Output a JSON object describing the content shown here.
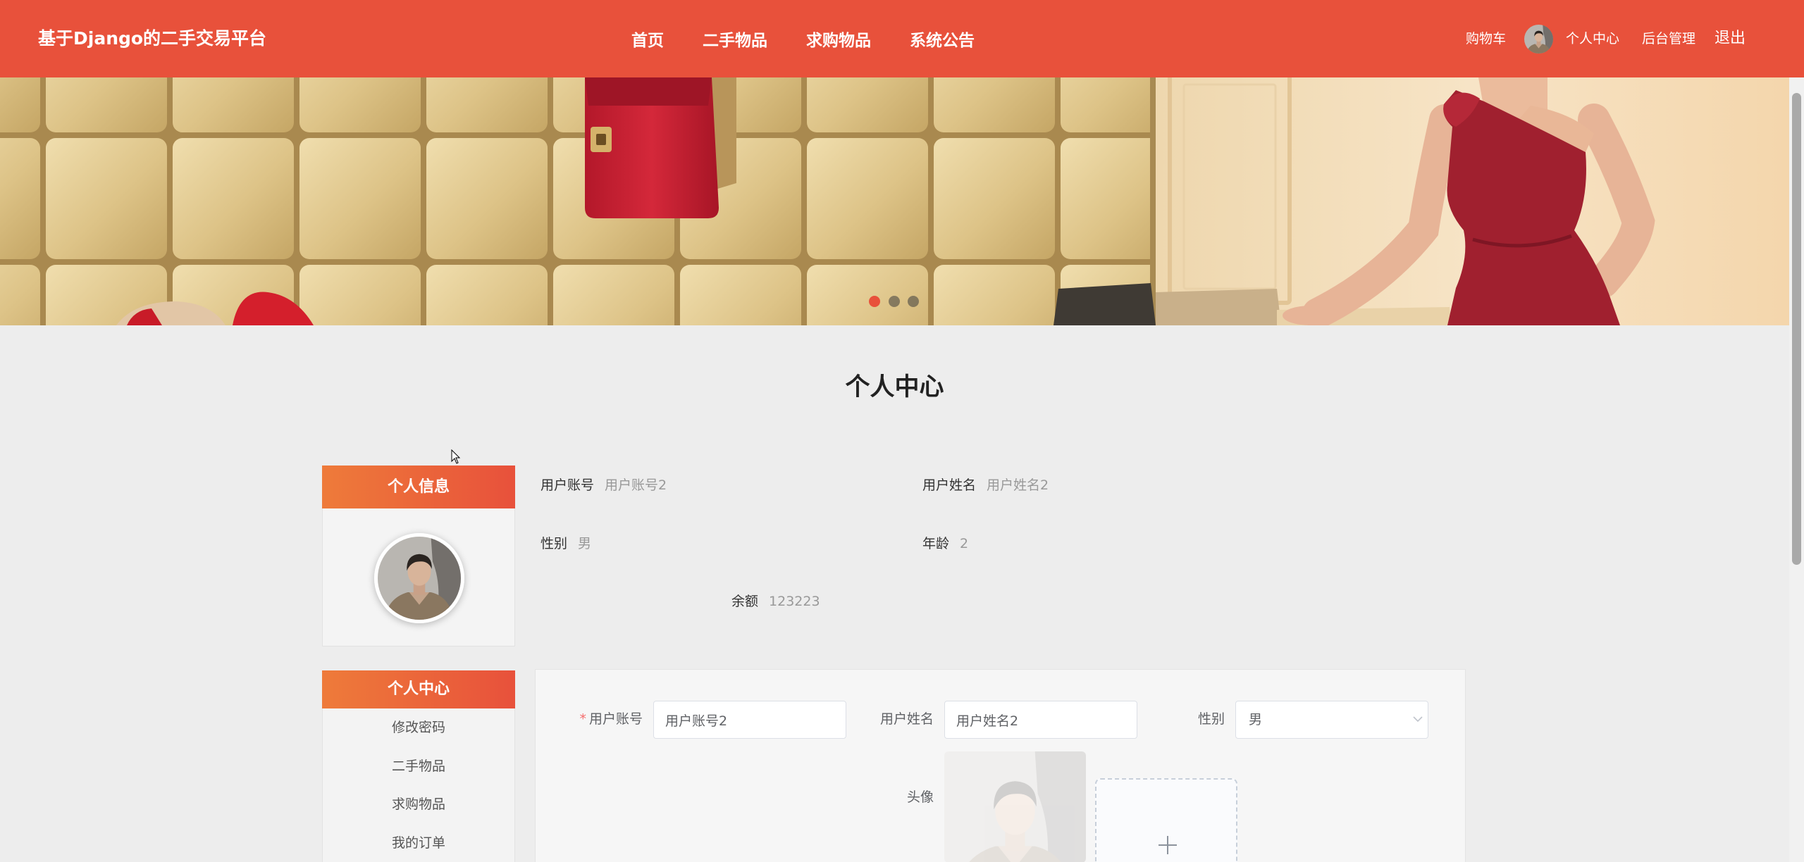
{
  "colors": {
    "brand": "#E8513B",
    "accent": "#EE7B3A",
    "required": "#F56C6C",
    "page_bg": "#EDEDED"
  },
  "icons": {
    "avatar": "user-avatar-photo",
    "select": "chevron-down-icon",
    "upload": "plus-icon"
  },
  "header": {
    "site_title": "基于Django的二手交易平台",
    "nav": [
      {
        "label": "首页"
      },
      {
        "label": "二手物品"
      },
      {
        "label": "求购物品"
      },
      {
        "label": "系统公告"
      }
    ],
    "cart_label": "购物车",
    "profile_label": "个人中心",
    "admin_label": "后台管理",
    "logout_label": "退出"
  },
  "banner": {
    "slide_count": 3,
    "active_slide": 1
  },
  "page_title": "个人中心",
  "sidebar": {
    "info_title": "个人信息",
    "menu_title": "个人中心",
    "menu_items": [
      {
        "label": "修改密码"
      },
      {
        "label": "二手物品"
      },
      {
        "label": "求购物品"
      },
      {
        "label": "我的订单"
      }
    ]
  },
  "profile": {
    "account": {
      "label": "用户账号",
      "value": "用户账号2"
    },
    "name": {
      "label": "用户姓名",
      "value": "用户姓名2"
    },
    "gender": {
      "label": "性别",
      "value": "男"
    },
    "age": {
      "label": "年龄",
      "value": "2"
    },
    "balance": {
      "label": "余额",
      "value": "123223"
    }
  },
  "form": {
    "required_mark": "*",
    "account": {
      "label": "用户账号",
      "value": "用户账号2"
    },
    "name": {
      "label": "用户姓名",
      "value": "用户姓名2"
    },
    "gender": {
      "label": "性别",
      "selected": "男"
    },
    "avatar": {
      "label": "头像"
    }
  }
}
